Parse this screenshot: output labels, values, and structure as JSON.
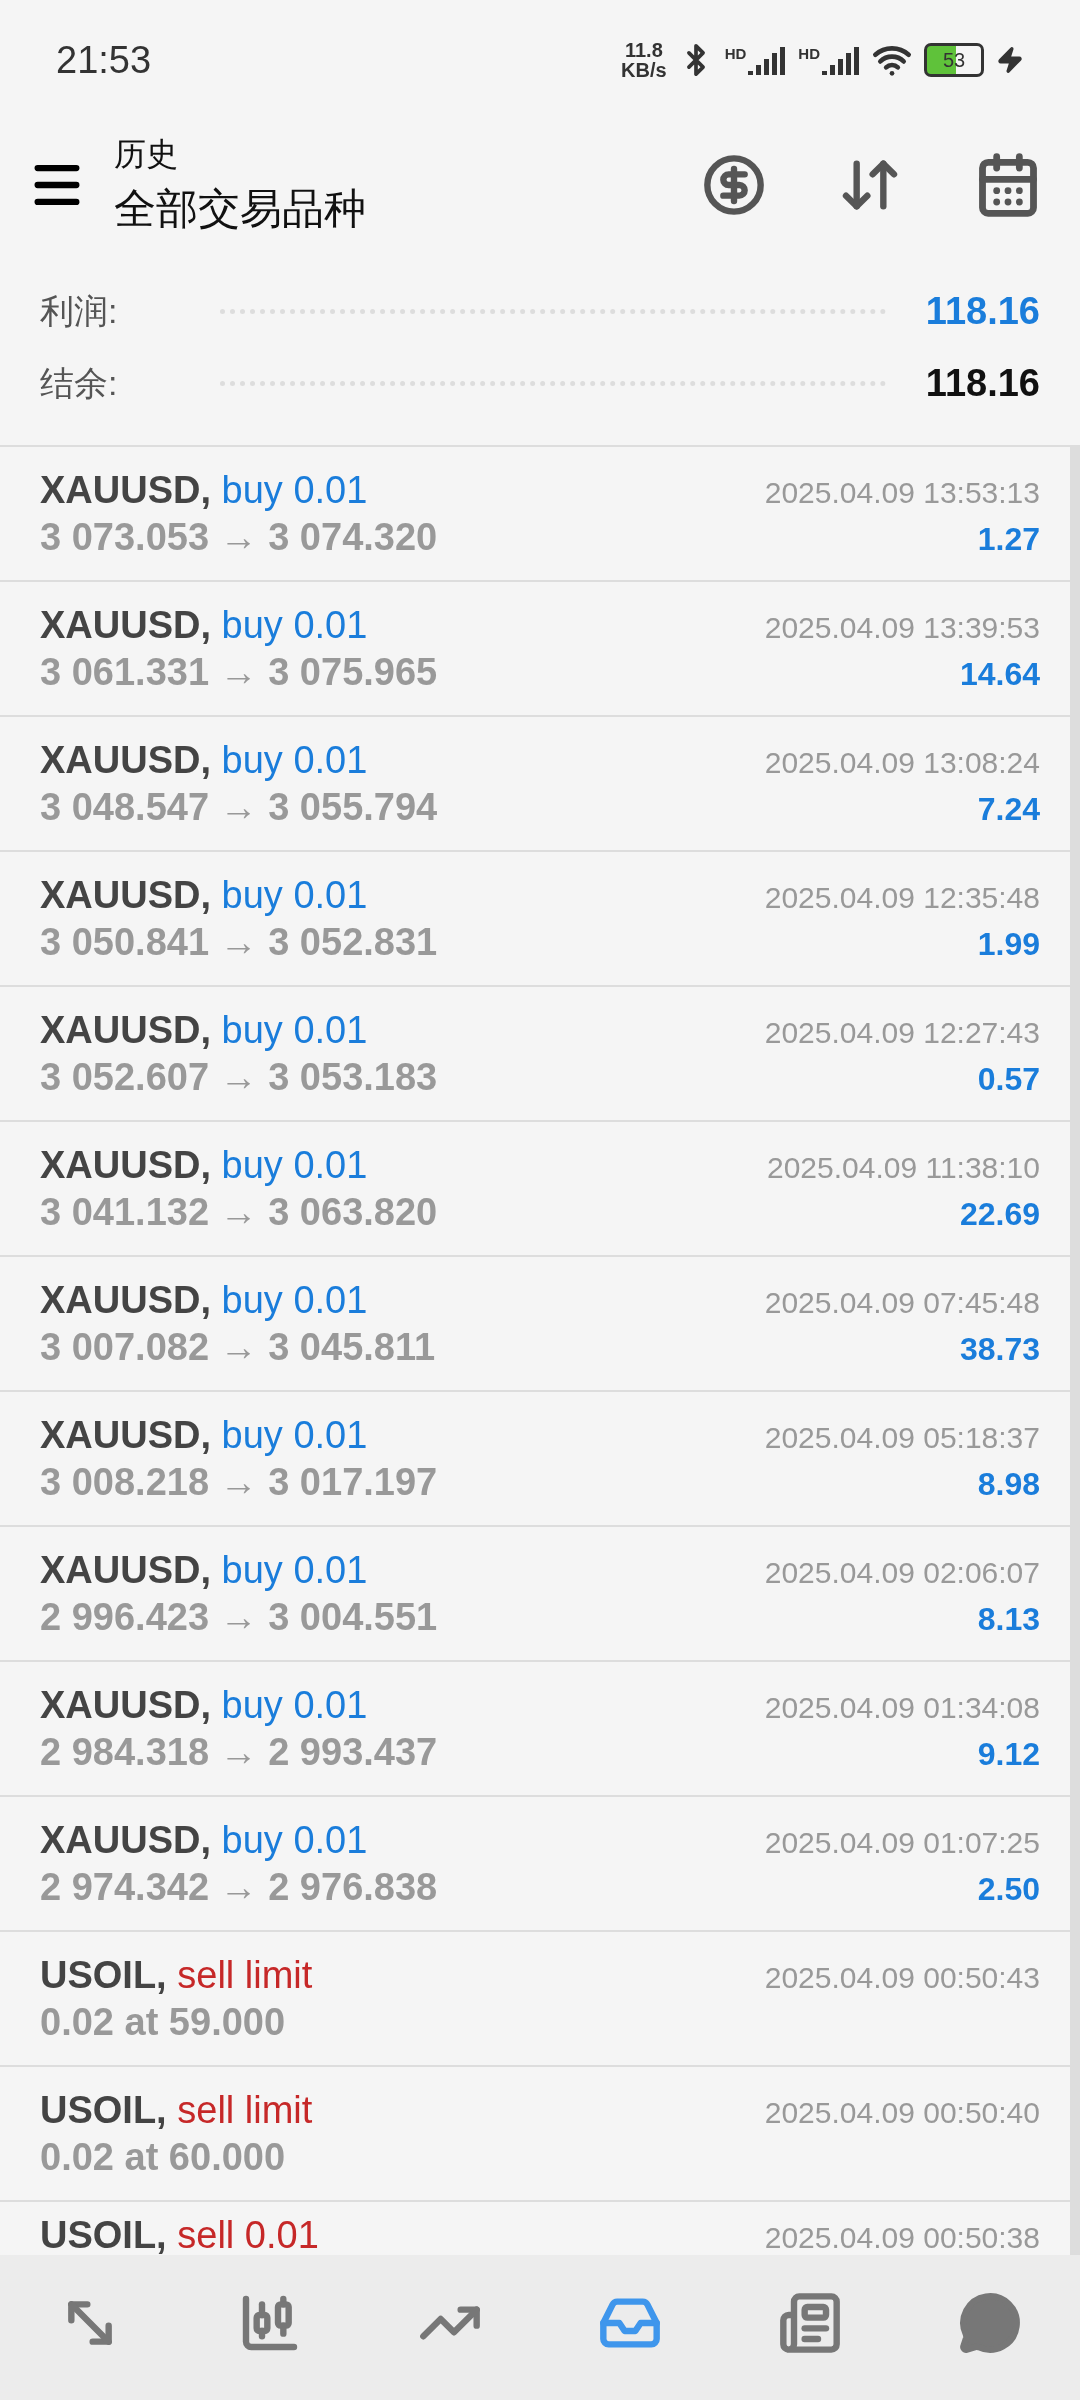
{
  "status_bar": {
    "time": "21:53",
    "speed": "11.8",
    "speed_unit": "KB/s",
    "signal_labels": [
      "HD",
      "HD"
    ],
    "battery": "53",
    "charging": true
  },
  "header": {
    "subtitle": "历史",
    "title": "全部交易品种"
  },
  "summary": [
    {
      "label": "利润:",
      "value": "118.16",
      "highlight": true
    },
    {
      "label": "结余:",
      "value": "118.16",
      "highlight": false
    }
  ],
  "deals": [
    {
      "kind": "deal",
      "symbol": "XAUUSD,",
      "action": "buy 0.01",
      "color": "#1a7ddb",
      "time": "2025.04.09 13:53:13",
      "detail": "3 073.053 → 3 074.320",
      "profit": "1.27"
    },
    {
      "kind": "deal",
      "symbol": "XAUUSD,",
      "action": "buy 0.01",
      "color": "#1a7ddb",
      "time": "2025.04.09 13:39:53",
      "detail": "3 061.331 → 3 075.965",
      "profit": "14.64"
    },
    {
      "kind": "deal",
      "symbol": "XAUUSD,",
      "action": "buy 0.01",
      "color": "#1a7ddb",
      "time": "2025.04.09 13:08:24",
      "detail": "3 048.547 → 3 055.794",
      "profit": "7.24"
    },
    {
      "kind": "deal",
      "symbol": "XAUUSD,",
      "action": "buy 0.01",
      "color": "#1a7ddb",
      "time": "2025.04.09 12:35:48",
      "detail": "3 050.841 → 3 052.831",
      "profit": "1.99"
    },
    {
      "kind": "deal",
      "symbol": "XAUUSD,",
      "action": "buy 0.01",
      "color": "#1a7ddb",
      "time": "2025.04.09 12:27:43",
      "detail": "3 052.607 → 3 053.183",
      "profit": "0.57"
    },
    {
      "kind": "deal",
      "symbol": "XAUUSD,",
      "action": "buy 0.01",
      "color": "#1a7ddb",
      "time": "2025.04.09 11:38:10",
      "detail": "3 041.132 → 3 063.820",
      "profit": "22.69"
    },
    {
      "kind": "deal",
      "symbol": "XAUUSD,",
      "action": "buy 0.01",
      "color": "#1a7ddb",
      "time": "2025.04.09 07:45:48",
      "detail": "3 007.082 → 3 045.811",
      "profit": "38.73"
    },
    {
      "kind": "deal",
      "symbol": "XAUUSD,",
      "action": "buy 0.01",
      "color": "#1a7ddb",
      "time": "2025.04.09 05:18:37",
      "detail": "3 008.218 → 3 017.197",
      "profit": "8.98"
    },
    {
      "kind": "deal",
      "symbol": "XAUUSD,",
      "action": "buy 0.01",
      "color": "#1a7ddb",
      "time": "2025.04.09 02:06:07",
      "detail": "2 996.423 → 3 004.551",
      "profit": "8.13"
    },
    {
      "kind": "deal",
      "symbol": "XAUUSD,",
      "action": "buy 0.01",
      "color": "#1a7ddb",
      "time": "2025.04.09 01:34:08",
      "detail": "2 984.318 → 2 993.437",
      "profit": "9.12"
    },
    {
      "kind": "deal",
      "symbol": "XAUUSD,",
      "action": "buy 0.01",
      "color": "#1a7ddb",
      "time": "2025.04.09 01:07:25",
      "detail": "2 974.342 → 2 976.838",
      "profit": "2.50"
    },
    {
      "kind": "order",
      "symbol": "USOIL,",
      "action": "sell limit",
      "color": "#c62828",
      "time": "2025.04.09 00:50:43",
      "detail": "0.02 at 59.000"
    },
    {
      "kind": "order",
      "symbol": "USOIL,",
      "action": "sell limit",
      "color": "#c62828",
      "time": "2025.04.09 00:50:40",
      "detail": "0.02 at 60.000"
    },
    {
      "kind": "partial",
      "symbol": "USOIL,",
      "action": "sell 0.01",
      "color": "#c62828",
      "time": "2025.04.09 00:50:38"
    }
  ],
  "nav": [
    {
      "selected": false
    },
    {
      "selected": false
    },
    {
      "selected": false
    },
    {
      "selected": true
    },
    {
      "selected": false
    },
    {
      "selected": false
    }
  ]
}
